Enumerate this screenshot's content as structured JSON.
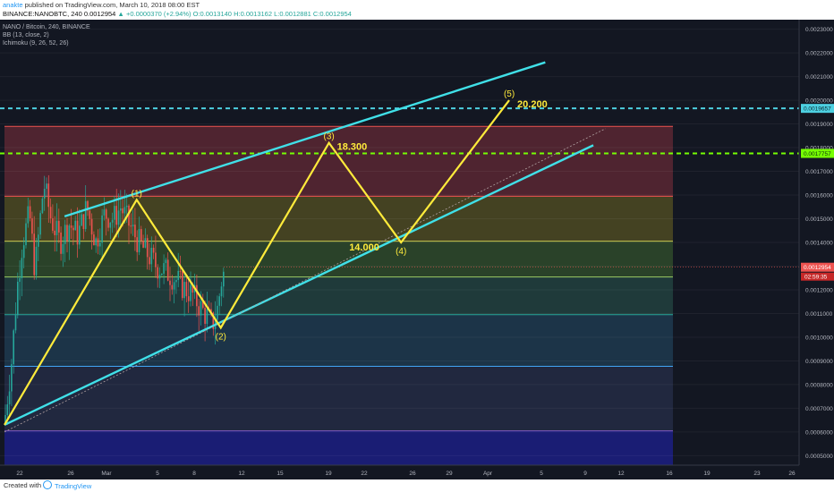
{
  "header": {
    "author": "anakte",
    "published": "published on TradingView.com, March 10, 2018 08:00 EST",
    "symbol": "BINANCE:NANOBTC, 240",
    "last": "0.0012954",
    "change": "+0.0000370 (+2.94%)",
    "ohlc": "O:0.0013140 H:0.0013162 L:0.0012881 C:0.0012954"
  },
  "legend": {
    "title": "NANO / Bitcoin, 240, BINANCE",
    "bb": "BB (13, close, 2)",
    "ichimoku": "Ichimoku (9, 26, 52, 26)"
  },
  "footer": {
    "created": "Created with",
    "brand": "TradingView"
  },
  "colors": {
    "background": "#131722",
    "wave": "#ffeb3b",
    "channel": "#40e0e8",
    "cyan_level": "#4dd0e1",
    "green_level": "#76ff03",
    "price_tag": "#ef5350",
    "candle_up": "#26a69a",
    "candle_down": "#ef5350"
  },
  "chart_data": {
    "type": "line",
    "title": "NANO / Bitcoin, 240, BINANCE",
    "xlabel": "",
    "ylabel": "",
    "x_ticks": [
      "22",
      "26",
      "Mar",
      "5",
      "8",
      "12",
      "15",
      "19",
      "22",
      "26",
      "29",
      "Apr",
      "5",
      "9",
      "12",
      "16",
      "19",
      "23",
      "26"
    ],
    "y_ticks": [
      "0.0023000",
      "0.0022000",
      "0.0021000",
      "0.0020000",
      "0.0019000",
      "0.0018000",
      "0.0017000",
      "0.0016000",
      "0.0015000",
      "0.0014000",
      "0.0013000",
      "0.0012000",
      "0.0011000",
      "0.0010000",
      "0.0009000",
      "0.0008000",
      "0.0007000",
      "0.0006000",
      "0.0005000"
    ],
    "ylim": [
      0.00046,
      0.00234
    ],
    "y_tags": {
      "cyan": "0.0019657",
      "green": "0.0017757",
      "price": "0.0012954",
      "countdown": "02:59:35"
    },
    "horizontal_levels": [
      {
        "name": "cyan-dashed",
        "value": 0.0019657
      },
      {
        "name": "green-dashed",
        "value": 0.0017757
      },
      {
        "name": "fib-1",
        "value": 0.00189
      },
      {
        "name": "fib-2",
        "value": 0.001595
      },
      {
        "name": "fib-3",
        "value": 0.001405
      },
      {
        "name": "fib-4",
        "value": 0.001254
      },
      {
        "name": "fib-5",
        "value": 0.001095
      },
      {
        "name": "fib-6",
        "value": 0.000877
      },
      {
        "name": "fib-7",
        "value": 0.000605
      }
    ],
    "wave_points": [
      {
        "label": "",
        "date": "Feb 19",
        "y": 0.00063
      },
      {
        "label": "(1)",
        "date": "Mar 2",
        "y": 0.00158,
        "value_label": ""
      },
      {
        "label": "(2)",
        "date": "Mar 9",
        "y": 0.00104,
        "value_label": ""
      },
      {
        "label": "(3)",
        "date": "Mar 18",
        "y": 0.00182,
        "value_label": "18.300"
      },
      {
        "label": "(4)",
        "date": "Mar 24",
        "y": 0.0014,
        "value_label": "14.000"
      },
      {
        "label": "(5)",
        "date": "Apr 2",
        "y": 0.002,
        "value_label": "20.200"
      }
    ],
    "channel_lines": [
      {
        "name": "upper",
        "p1": {
          "date": "Feb 24",
          "y": 0.00151
        },
        "p2": {
          "date": "Apr 5",
          "y": 0.00216
        }
      },
      {
        "name": "lower",
        "p1": {
          "date": "Feb 19",
          "y": 0.00063
        },
        "p2": {
          "date": "Apr 9",
          "y": 0.00181
        }
      },
      {
        "name": "dotted-trend",
        "p1": {
          "date": "Feb 19",
          "y": 0.0006
        },
        "p2": {
          "date": "Apr 10",
          "y": 0.00188
        }
      }
    ]
  }
}
